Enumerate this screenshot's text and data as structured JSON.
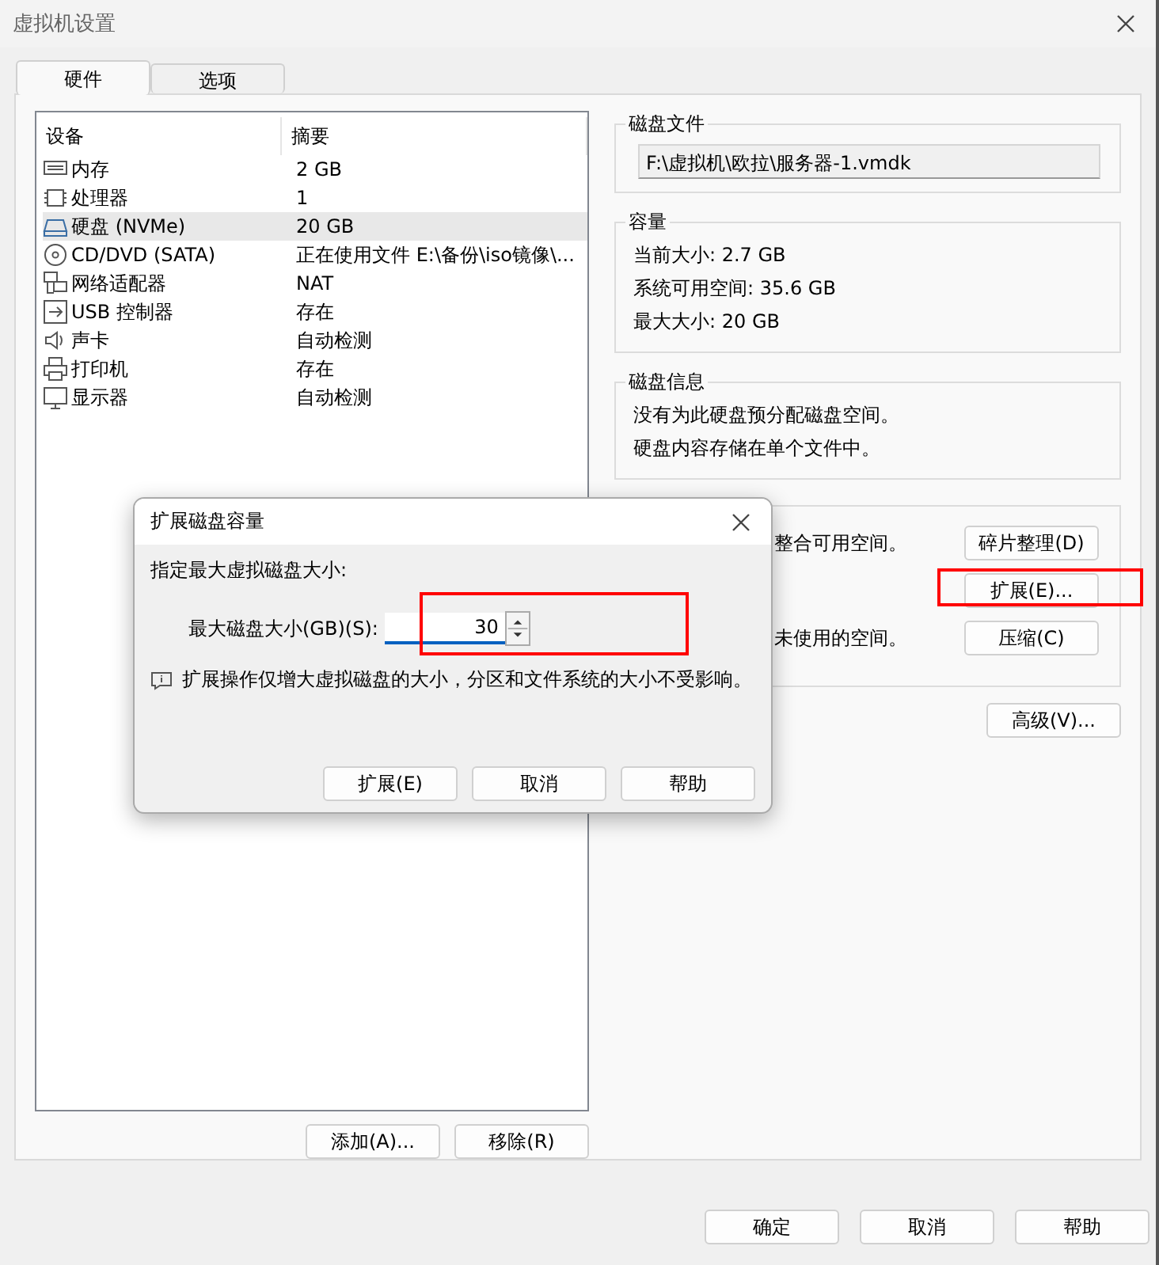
{
  "window": {
    "title": "虚拟机设置"
  },
  "tabs": [
    {
      "label": "硬件",
      "selected": true
    },
    {
      "label": "选项",
      "selected": false
    }
  ],
  "devices": {
    "columns": [
      "设备",
      "摘要"
    ],
    "rows": [
      {
        "kind": "memory",
        "device": "内存",
        "summary": "2 GB",
        "selected": false
      },
      {
        "kind": "cpu",
        "device": "处理器",
        "summary": "1",
        "selected": false
      },
      {
        "kind": "disk",
        "device": "硬盘 (NVMe)",
        "summary": "20 GB",
        "selected": true
      },
      {
        "kind": "cdrom",
        "device": "CD/DVD (SATA)",
        "summary": "正在使用文件 E:\\备份\\iso镜像\\...",
        "selected": false
      },
      {
        "kind": "network",
        "device": "网络适配器",
        "summary": "NAT",
        "selected": false
      },
      {
        "kind": "usb",
        "device": "USB 控制器",
        "summary": "存在",
        "selected": false
      },
      {
        "kind": "sound",
        "device": "声卡",
        "summary": "自动检测",
        "selected": false
      },
      {
        "kind": "printer",
        "device": "打印机",
        "summary": "存在",
        "selected": false
      },
      {
        "kind": "display",
        "device": "显示器",
        "summary": "自动检测",
        "selected": false
      }
    ]
  },
  "device_buttons": [
    "添加(A)...",
    "移除(R)"
  ],
  "disk_file": {
    "title": "磁盘文件",
    "path": "F:\\虚拟机\\欧拉\\服务器-1.vmdk"
  },
  "capacity": {
    "title": "容量",
    "lines": [
      "当前大小: 2.7 GB",
      "系统可用空间: 35.6 GB",
      "最大大小: 20 GB"
    ]
  },
  "disk_info": {
    "title": "磁盘信息",
    "lines": [
      "没有为此硬盘预分配磁盘空间。",
      "硬盘内容存储在单个文件中。"
    ]
  },
  "utilities": [
    {
      "text": "整合可用空间。",
      "button": "碎片整理(D)",
      "highlighted": false
    },
    {
      "button": "扩展(E)...",
      "highlighted": true
    },
    {
      "text": "未使用的空间。",
      "button": "压缩(C)",
      "highlighted": false
    }
  ],
  "advanced_button": "高级(V)...",
  "footer_buttons": [
    "确定",
    "取消",
    "帮助"
  ],
  "dialog": {
    "title": "扩展磁盘容量",
    "prompt": "指定最大虚拟磁盘大小:",
    "size_label": "最大磁盘大小(GB)(S):",
    "size_value": "30",
    "size_highlighted": true,
    "note": "扩展操作仅增大虚拟磁盘的大小，分区和文件系统的大小不受影响。",
    "buttons": [
      "扩展(E)",
      "取消",
      "帮助"
    ]
  }
}
